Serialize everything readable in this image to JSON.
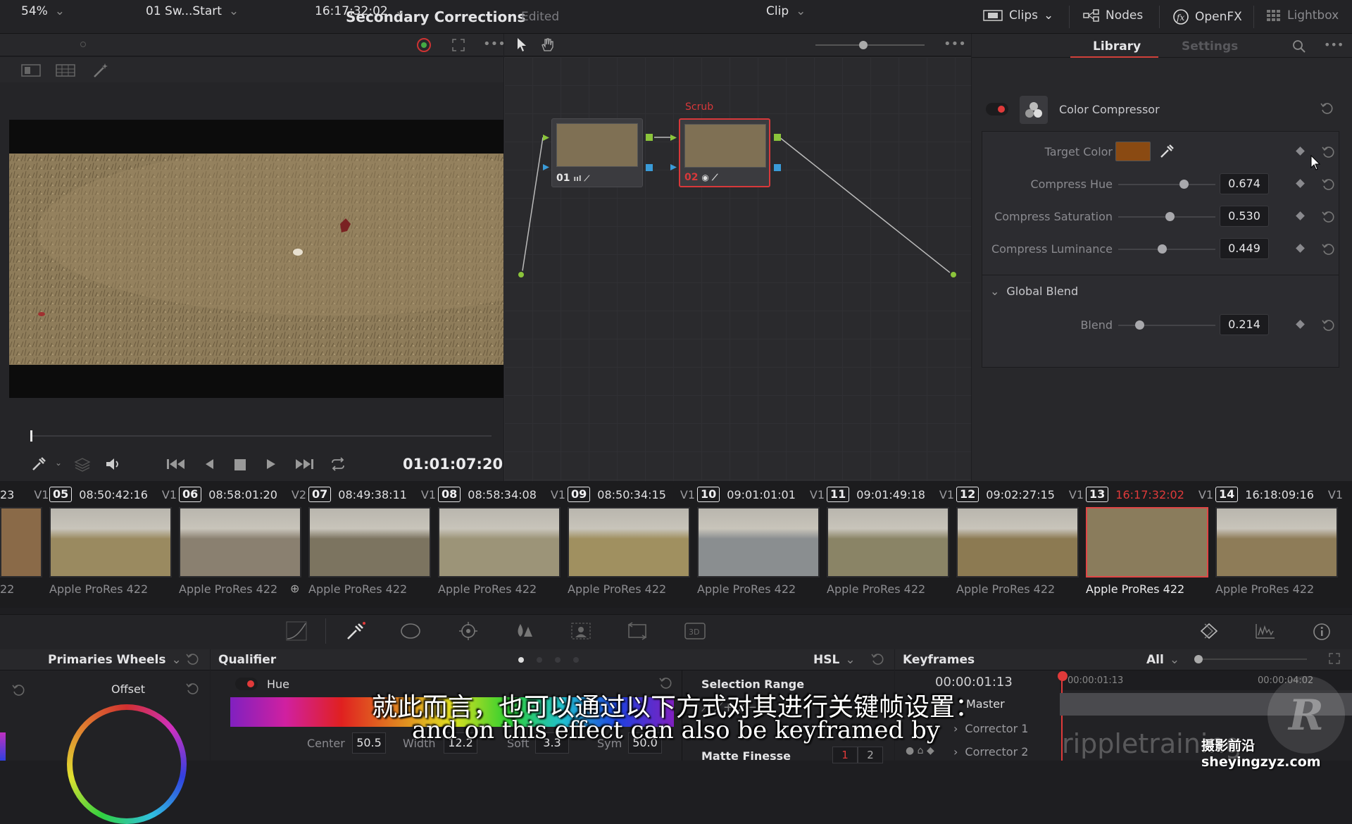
{
  "topbar": {
    "title": "Secondary Corrections",
    "status": "Edited",
    "clips_label": "Clips",
    "nodes_label": "Nodes",
    "openfx_label": "OpenFX",
    "lightbox_label": "Lightbox"
  },
  "viewer": {
    "zoom": "54%",
    "clip_name": "01 Sw...Start",
    "source_timecode": "16:17:32:02",
    "timecode": "01:01:07:20"
  },
  "node_editor": {
    "mode": "Clip",
    "node1_label": "01",
    "node2_label": "02",
    "node2_title": "Scrub"
  },
  "panel": {
    "tab_library": "Library",
    "tab_settings": "Settings",
    "effect_name": "Color Compressor",
    "target_color_label": "Target Color",
    "target_color": "#8a4a12",
    "params": [
      {
        "label": "Compress Hue",
        "value": "0.674",
        "level": 0.674
      },
      {
        "label": "Compress Saturation",
        "value": "0.530",
        "level": 0.53
      },
      {
        "label": "Compress Luminance",
        "value": "0.449",
        "level": 0.449
      }
    ],
    "global_blend_label": "Global Blend",
    "blend": {
      "label": "Blend",
      "value": "0.214",
      "level": 0.214
    }
  },
  "timeline": {
    "first_num": "23",
    "first_track": "V1",
    "first_codec": "22",
    "clips": [
      {
        "num": "05",
        "tc": "08:50:42:16",
        "track": "V1",
        "codec": "Apple ProRes 422"
      },
      {
        "num": "06",
        "tc": "08:58:01:20",
        "track": "V2",
        "codec": "Apple ProRes 422"
      },
      {
        "num": "07",
        "tc": "08:49:38:11",
        "track": "V1",
        "codec": "Apple ProRes 422"
      },
      {
        "num": "08",
        "tc": "08:58:34:08",
        "track": "V1",
        "codec": "Apple ProRes 422"
      },
      {
        "num": "09",
        "tc": "08:50:34:15",
        "track": "V1",
        "codec": "Apple ProRes 422"
      },
      {
        "num": "10",
        "tc": "09:01:01:01",
        "track": "V1",
        "codec": "Apple ProRes 422"
      },
      {
        "num": "11",
        "tc": "09:01:49:18",
        "track": "V1",
        "codec": "Apple ProRes 422"
      },
      {
        "num": "12",
        "tc": "09:02:27:15",
        "track": "V1",
        "codec": "Apple ProRes 422"
      },
      {
        "num": "13",
        "tc": "16:17:32:02",
        "track": "V1",
        "codec": "Apple ProRes 422"
      },
      {
        "num": "14",
        "tc": "16:18:09:16",
        "track": "V1",
        "codec": "Apple ProRes 422"
      }
    ]
  },
  "bottom": {
    "wheels_mode": "Primaries Wheels",
    "offset_label": "Offset",
    "qualifier_label": "Qualifier",
    "qualifier_mode": "HSL",
    "hue_label": "Hue",
    "center_label": "Center",
    "center_value": "50.5",
    "width_label": "Width",
    "width_value": "12.2",
    "soft_label": "Soft",
    "soft_value": "3.3",
    "sym_label": "Sym",
    "sym_value": "50.0",
    "selection_range": "Selection Range",
    "matte_finesse": "Matte Finesse",
    "matte_btn1": "1",
    "matte_btn2": "2",
    "keyframes_label": "Keyframes",
    "keyframes_filter": "All",
    "kf_timecode": "00:00:01:13",
    "kf_ruler_start": "00:00:01:13",
    "kf_ruler_end": "00:00:04:02",
    "kf_master": "Master",
    "kf_corrector1": "Corrector 1",
    "kf_corrector2": "Corrector 2"
  },
  "subtitle": {
    "zh": "就此而言，也可以通过以下方式对其进行关键帧设置：",
    "en": "and on this effect can also be keyframed by"
  },
  "watermark": {
    "brand": "rippletraining",
    "site": "摄影前沿 sheyingzyz.com"
  }
}
